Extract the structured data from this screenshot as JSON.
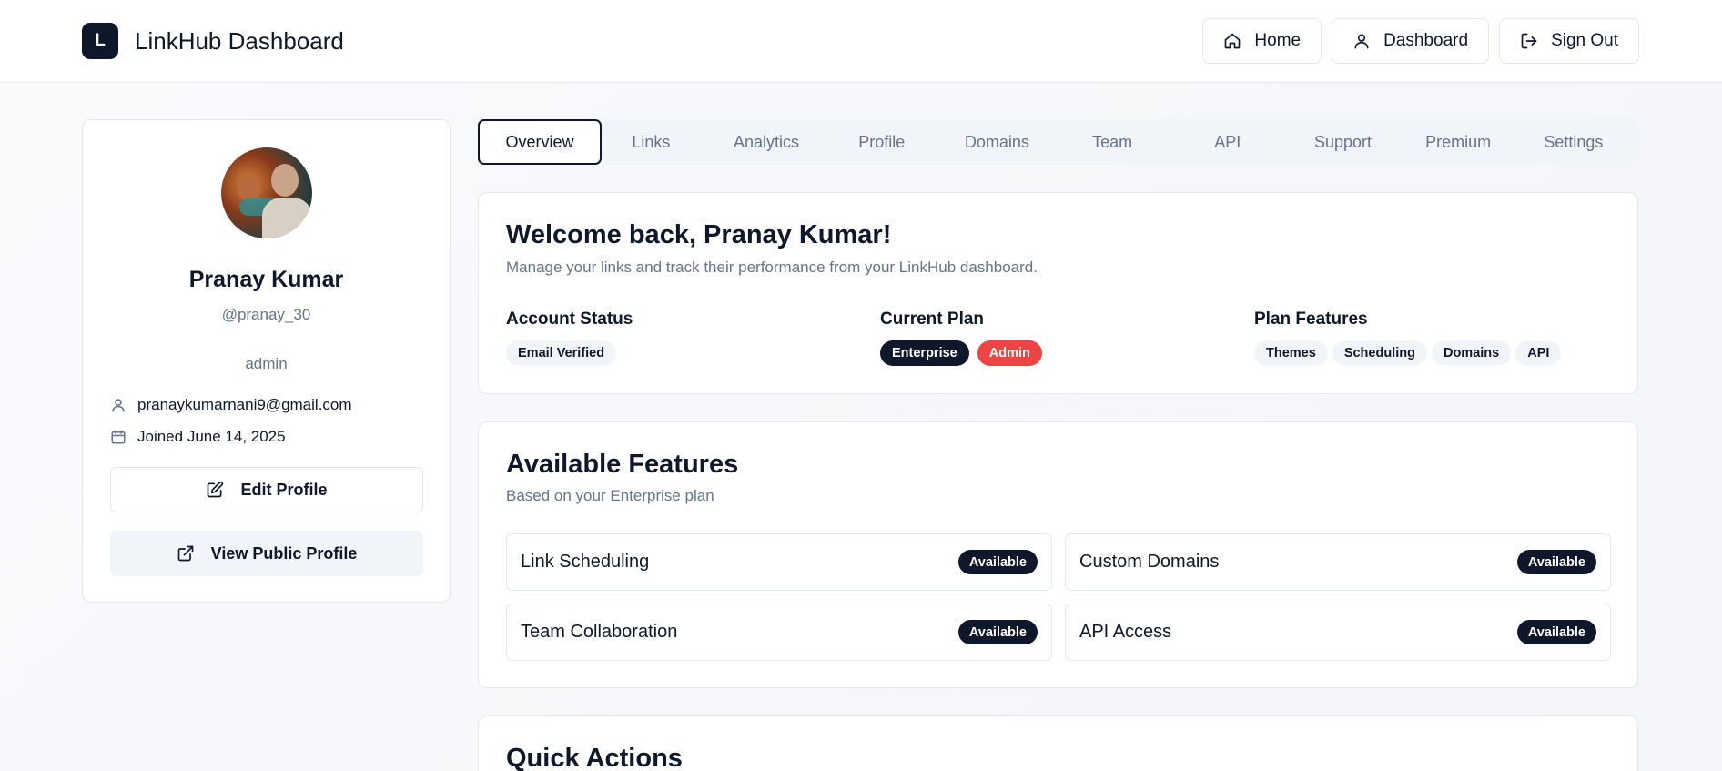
{
  "header": {
    "logo_letter": "L",
    "title": "LinkHub Dashboard",
    "nav": [
      {
        "label": "Home",
        "icon": "home-icon"
      },
      {
        "label": "Dashboard",
        "icon": "user-icon"
      },
      {
        "label": "Sign Out",
        "icon": "sign-out-icon"
      }
    ]
  },
  "profile": {
    "name": "Pranay Kumar",
    "handle": "@pranay_30",
    "role": "admin",
    "email": "pranaykumarnani9@gmail.com",
    "joined": "Joined June 14, 2025",
    "edit_label": "Edit Profile",
    "view_label": "View Public Profile"
  },
  "tabs": [
    "Overview",
    "Links",
    "Analytics",
    "Profile",
    "Domains",
    "Team",
    "API",
    "Support",
    "Premium",
    "Settings"
  ],
  "active_tab": "Overview",
  "welcome": {
    "title": "Welcome back, Pranay Kumar!",
    "subtitle": "Manage your links and track their performance from your LinkHub dashboard.",
    "account_status": {
      "heading": "Account Status",
      "badges": [
        "Email Verified"
      ]
    },
    "current_plan": {
      "heading": "Current Plan",
      "plan": "Enterprise",
      "role_badge": "Admin"
    },
    "plan_features": {
      "heading": "Plan Features",
      "badges": [
        "Themes",
        "Scheduling",
        "Domains",
        "API"
      ]
    }
  },
  "features": {
    "title": "Available Features",
    "subtitle": "Based on your Enterprise plan",
    "items": [
      {
        "label": "Link Scheduling",
        "status": "Available"
      },
      {
        "label": "Custom Domains",
        "status": "Available"
      },
      {
        "label": "Team Collaboration",
        "status": "Available"
      },
      {
        "label": "API Access",
        "status": "Available"
      }
    ]
  },
  "quick_actions": {
    "title": "Quick Actions"
  },
  "colors": {
    "primary": "#0f172a",
    "admin_badge": "#ef4444",
    "muted": "#64748b",
    "border": "#e2e8f0"
  }
}
